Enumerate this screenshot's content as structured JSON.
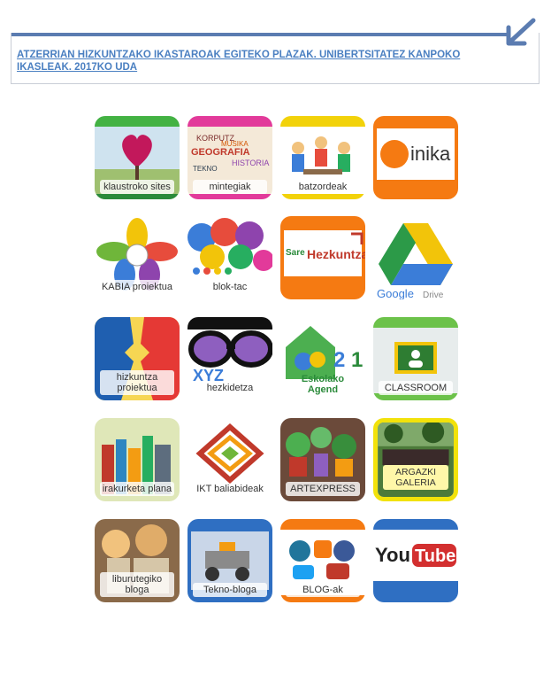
{
  "header": {
    "title_link": "ATZERRIAN HIZKUNTZAKO IKASTAROAK EGITEKO PLAZAK. UNIBERTSITATEZ KANPOKO IKASLEAK. 2017KO UDA"
  },
  "colors": {
    "link": "#4a7fc1",
    "header_bar": "#5b7cb1"
  },
  "tiles": [
    {
      "label": "klaustroko sites",
      "icon": "heart-tree-icon",
      "accent": "#43b243"
    },
    {
      "label": "mintegiak",
      "icon": "word-cloud-icon",
      "accent": "#e23a9a"
    },
    {
      "label": "batzordeak",
      "icon": "people-meeting-icon",
      "accent": "#f2d20a"
    },
    {
      "label": "inika",
      "icon": "inika-logo-icon",
      "accent": "#f57a12"
    },
    {
      "label": "KABIA proiektua",
      "icon": "kabia-flower-icon",
      "accent": "#6fb63a"
    },
    {
      "label": "blok-tac",
      "icon": "speech-bubbles-icon",
      "accent": "#e23a9a"
    },
    {
      "label": "Sare Hezkuntza",
      "icon": "sare-hezkuntza-logo-icon",
      "accent": "#f57a12"
    },
    {
      "label": "Google Drive",
      "icon": "google-drive-icon",
      "accent": "#2c9a48"
    },
    {
      "label": "hizkuntza proiektua",
      "icon": "faces-profile-icon",
      "accent": "#1f5fb0"
    },
    {
      "label": "hezkidetza",
      "icon": "glasses-icon",
      "accent": "#444444"
    },
    {
      "label": "Eskolako Agend",
      "icon": "agenda21-logo-icon",
      "accent": "#4aa0d8"
    },
    {
      "label": "CLASSROOM",
      "icon": "classroom-icon",
      "accent": "#6cc24a"
    },
    {
      "label": "irakurketa plana",
      "icon": "books-icon",
      "accent": "#b8d26a"
    },
    {
      "label": "IKT baliabideak",
      "icon": "ikt-diamond-icon",
      "accent": "#e8e8e8"
    },
    {
      "label": "ARTEXPRESS",
      "icon": "art-plants-icon",
      "accent": "#6b4a3a"
    },
    {
      "label": "ARGAZKI GALERIA",
      "icon": "photo-gallery-icon",
      "accent": "#f2e20a"
    },
    {
      "label": "liburutegiko bloga",
      "icon": "kids-reading-icon",
      "accent": "#8a6a4a"
    },
    {
      "label": "Tekno-bloga",
      "icon": "robot-kit-icon",
      "accent": "#2f6fc2"
    },
    {
      "label": "BLOG-ak",
      "icon": "blog-logos-icon",
      "accent": "#f57a12"
    },
    {
      "label": "YouTube",
      "icon": "youtube-logo-icon",
      "accent": "#2f6fc2"
    }
  ]
}
